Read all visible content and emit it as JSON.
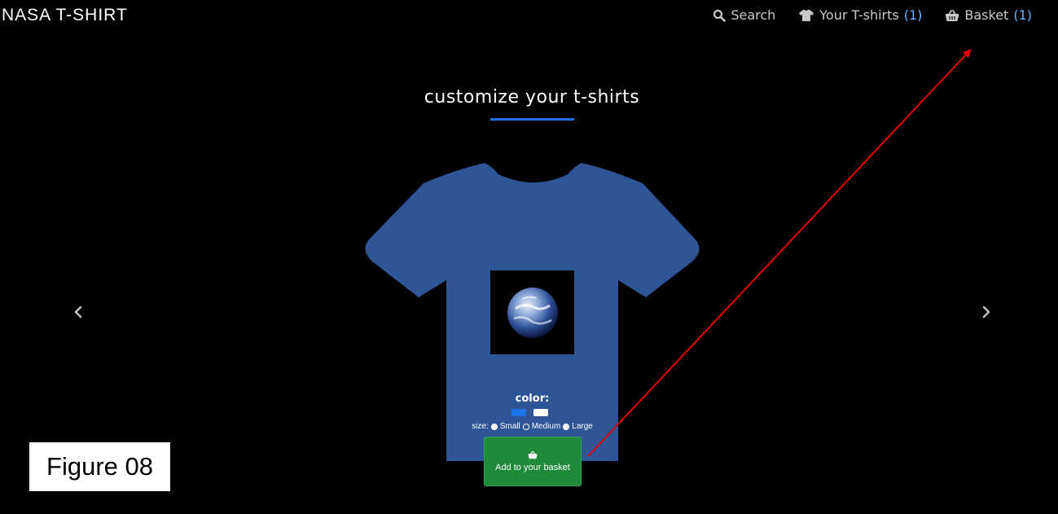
{
  "header": {
    "brand": "NASA T-SHIRT",
    "nav": {
      "search_label": "Search",
      "tshirts_label": "Your T-shirts",
      "tshirts_count": "(1)",
      "basket_label": "Basket",
      "basket_count": "(1)"
    }
  },
  "main": {
    "title": "customize your t-shirts",
    "shirt_color": "#2f5597",
    "color_label": "color:",
    "colors": [
      "#1a73e8",
      "#ffffff"
    ],
    "size_label": "size:",
    "sizes": [
      "Small",
      "Medium",
      "Large"
    ],
    "selected_size": "Medium",
    "add_button_label": "Add to your basket"
  },
  "annotation": {
    "figure_label": "Figure 08",
    "arrow_color": "#e00000"
  }
}
